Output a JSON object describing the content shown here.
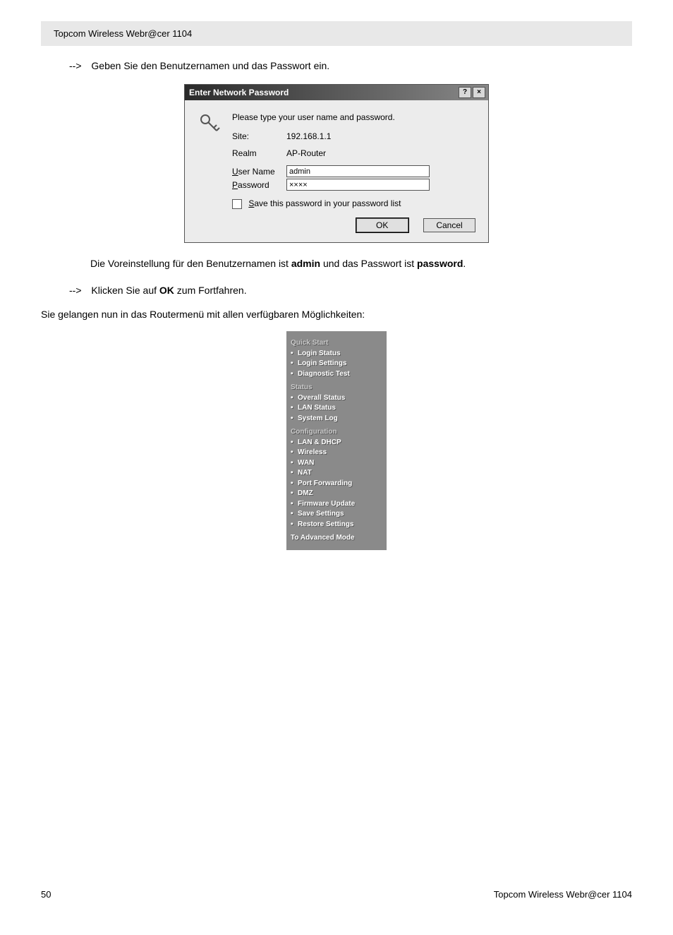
{
  "header": {
    "title": "Topcom Wireless Webr@cer 1104"
  },
  "instructions": {
    "line1": "Geben Sie den Benutzernamen und das Passwort ein.",
    "defaults_prefix": "Die Voreinstellung für den Benutzernamen ist ",
    "defaults_admin": "admin",
    "defaults_mid": " und das Passwort ist ",
    "defaults_password": "password",
    "defaults_suffix": ".",
    "line2_prefix": "Klicken Sie auf ",
    "line2_ok": "OK",
    "line2_suffix": " zum Fortfahren.",
    "line3": "Sie gelangen nun in das Routermenü mit allen verfügbaren Möglichkeiten:",
    "arrow": "-->"
  },
  "dialog": {
    "title": "Enter Network Password",
    "prompt": "Please type your user name and password.",
    "site_label": "Site:",
    "site_value": "192.168.1.1",
    "realm_label": "Realm",
    "realm_value": "AP-Router",
    "user_label_rest": "ser Name",
    "user_value": "admin",
    "pass_label_rest": "assword",
    "pass_value": "××××",
    "save_label_rest": "ave this password in your password list",
    "ok": "OK",
    "cancel": "Cancel",
    "help": "?",
    "close": "×"
  },
  "router_menu": {
    "sections": [
      {
        "title": "Quick Start",
        "items": [
          "Login Status",
          "Login Settings",
          "Diagnostic Test"
        ]
      },
      {
        "title": "Status",
        "items": [
          "Overall Status",
          "LAN Status",
          "System Log"
        ]
      },
      {
        "title": "Configuration",
        "items": [
          "LAN & DHCP",
          "Wireless",
          "WAN",
          "NAT",
          "Port Forwarding",
          "DMZ",
          "Firmware Update",
          "Save Settings",
          "Restore Settings"
        ]
      }
    ],
    "advanced": "To Advanced Mode"
  },
  "footer": {
    "page": "50",
    "title": "Topcom Wireless Webr@cer 1104"
  }
}
